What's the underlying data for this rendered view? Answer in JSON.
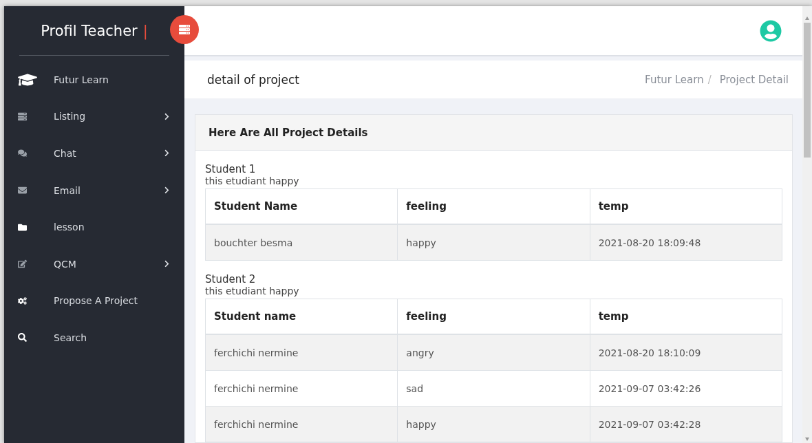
{
  "sidebar": {
    "title": "Profil Teacher",
    "title_bar": "|",
    "items": [
      {
        "label": "Futur Learn",
        "has_submenu": false
      },
      {
        "label": "Listing",
        "has_submenu": true
      },
      {
        "label": "Chat",
        "has_submenu": true
      },
      {
        "label": "Email",
        "has_submenu": true
      },
      {
        "label": "lesson",
        "has_submenu": false
      },
      {
        "label": "QCM",
        "has_submenu": true
      },
      {
        "label": "Propose A Project",
        "has_submenu": false
      },
      {
        "label": "Search",
        "has_submenu": false
      }
    ]
  },
  "page_header": {
    "title": "detail of project",
    "breadcrumb": [
      "Futur Learn",
      "Project Detail"
    ],
    "separator": "/"
  },
  "card": {
    "title": "Here Are All Project Details",
    "students": [
      {
        "heading": "Student 1",
        "note": "this etudiant happy",
        "columns": [
          "Student Name",
          "feeling",
          "temp"
        ],
        "rows": [
          [
            "bouchter besma",
            "happy",
            "2021-08-20 18:09:48"
          ]
        ]
      },
      {
        "heading": "Student 2",
        "note": "this etudiant happy",
        "columns": [
          "Student name",
          "feeling",
          "temp"
        ],
        "rows": [
          [
            "ferchichi nermine",
            "angry",
            "2021-08-20 18:10:09"
          ],
          [
            "ferchichi nermine",
            "sad",
            "2021-09-07 03:42:26"
          ],
          [
            "ferchichi nermine",
            "happy",
            "2021-09-07 03:42:28"
          ]
        ]
      }
    ]
  }
}
